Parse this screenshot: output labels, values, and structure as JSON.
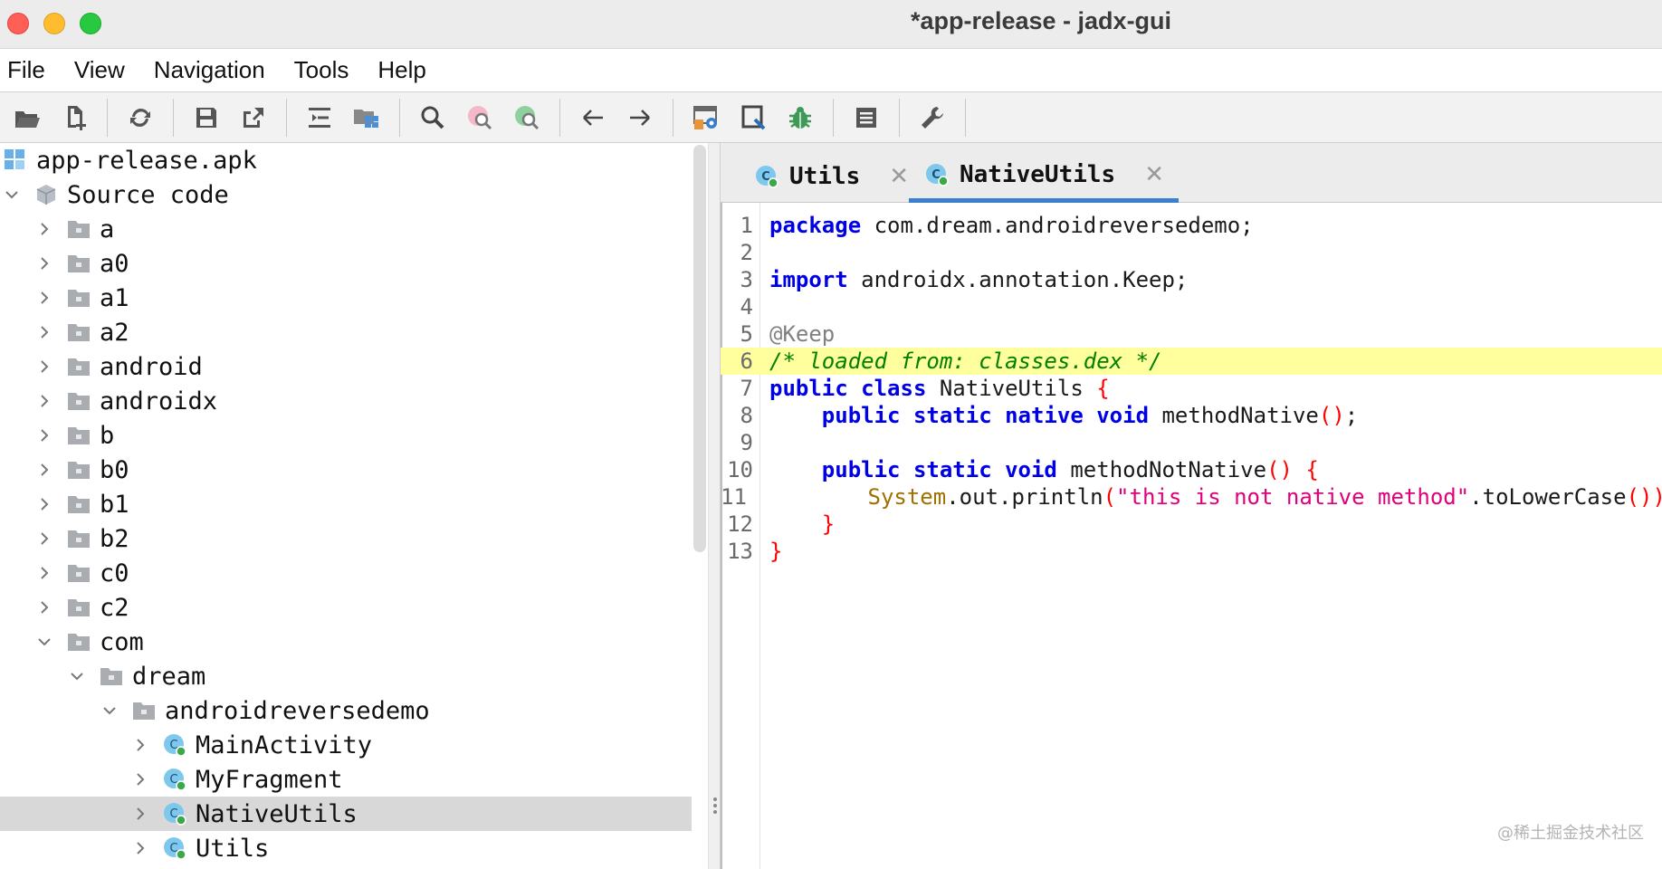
{
  "window": {
    "title": "*app-release - jadx-gui"
  },
  "menu": [
    "File",
    "View",
    "Navigation",
    "Tools",
    "Help"
  ],
  "toolbar": {
    "buttons": [
      "open-file",
      "add-files",
      "sync",
      "save-all",
      "export",
      "sync-with-editor",
      "flatten-packages",
      "search",
      "find-usage",
      "find-class",
      "back",
      "forward",
      "deobfuscation",
      "quark",
      "debug",
      "log-viewer",
      "preferences"
    ]
  },
  "tree": {
    "root": "app-release.apk",
    "source_code": "Source code",
    "packages": [
      "a",
      "a0",
      "a1",
      "a2",
      "android",
      "androidx",
      "b",
      "b0",
      "b1",
      "b2",
      "c0",
      "c2"
    ],
    "com": "com",
    "dream": "dream",
    "androidreversedemo": "androidreversedemo",
    "classes": [
      "MainActivity",
      "MyFragment",
      "NativeUtils",
      "Utils"
    ],
    "selected": "NativeUtils"
  },
  "tabs": [
    {
      "label": "Utils",
      "active": false
    },
    {
      "label": "NativeUtils",
      "active": true
    }
  ],
  "editor": {
    "line_numbers": [
      "1",
      "2",
      "3",
      "4",
      "5",
      "6",
      "7",
      "8",
      "9",
      "10",
      "11",
      "12",
      "13"
    ],
    "highlighted_line": 6,
    "code": {
      "l1_kw": "package",
      "l1_rest": " com.dream.androidreversedemo;",
      "l3_kw": "import",
      "l3_rest": " androidx.annotation.Keep;",
      "l5_ann": "@Keep",
      "l6_comment": "/* loaded from: classes.dex */",
      "l7_kw": "public class",
      "l7_name": " NativeUtils ",
      "l7_brace": "{",
      "l8_indent": "    ",
      "l8_kw": "public static native void",
      "l8_name": " methodNative",
      "l8_paren": "()",
      "l8_end": ";",
      "l10_indent": "    ",
      "l10_kw": "public static void",
      "l10_name": " methodNotNative",
      "l10_paren": "() {",
      "l11_indent": "        ",
      "l11_cls": "System",
      "l11_call": ".out.println",
      "l11_open": "(",
      "l11_str": "\"this is not native method\"",
      "l11_method": ".toLowerCase",
      "l11_close": "());",
      "l12_indent": "    ",
      "l12_brace": "}",
      "l13_brace": "}"
    }
  },
  "watermark": "@稀土掘金技术社区",
  "colors": {
    "keyword": "#0000e6",
    "comment": "#008000",
    "string": "#e0007a",
    "highlight": "#ffff9e",
    "selection": "#d8d8d8",
    "tab_active": "#3d7fcf"
  }
}
